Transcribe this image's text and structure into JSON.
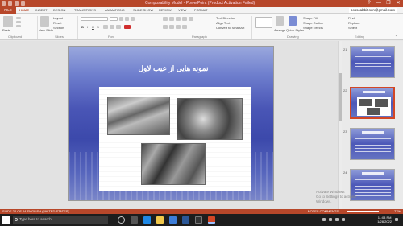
{
  "window": {
    "title": "Composability Model - PowerPoint (Product Activation Failed)",
    "controls": [
      "?",
      "—",
      "❐",
      "✕"
    ]
  },
  "ribbon_tabs": {
    "file": "FILE",
    "tabs": [
      "HOME",
      "INSERT",
      "DESIGN",
      "TRANSITIONS",
      "ANIMATIONS",
      "SLIDE SHOW",
      "REVIEW",
      "VIEW",
      "FORMAT"
    ],
    "account": "bosscabbit.sun@gmail.com"
  },
  "ribbon": {
    "groups": [
      "Clipboard",
      "Slides",
      "Font",
      "Paragraph",
      "Drawing",
      "Editing"
    ],
    "buttons": {
      "paste": "Paste",
      "new_slide": "New Slide",
      "layout": "Layout",
      "reset": "Reset",
      "section": "Section",
      "text_direction": "Text Direction",
      "align_text": "Align Text",
      "convert_smartart": "Convert to SmartArt",
      "arrange": "Arrange",
      "quick_styles": "Quick Styles",
      "shape_fill": "Shape Fill",
      "shape_outline": "Shape Outline",
      "shape_effects": "Shape Effects",
      "find": "Find",
      "replace": "Replace",
      "select": "Select"
    }
  },
  "slide": {
    "title": "نمونه هایی از عیب لاول"
  },
  "thumbnails": [
    {
      "number": "21",
      "selected": false
    },
    {
      "number": "22",
      "selected": true
    },
    {
      "number": "23",
      "selected": false
    },
    {
      "number": "24",
      "selected": false
    }
  ],
  "watermark": {
    "line1": "Activate Windows",
    "line2": "Go to Settings to activate Windows."
  },
  "status": {
    "left": "SLIDE 22 OF 24   ENGLISH (UNITED STATES)",
    "right": "NOTES   COMMENTS",
    "zoom": "77%"
  },
  "taskbar": {
    "search_placeholder": "Type here to search",
    "time": "11:08 PM",
    "date": "1/28/2022"
  }
}
